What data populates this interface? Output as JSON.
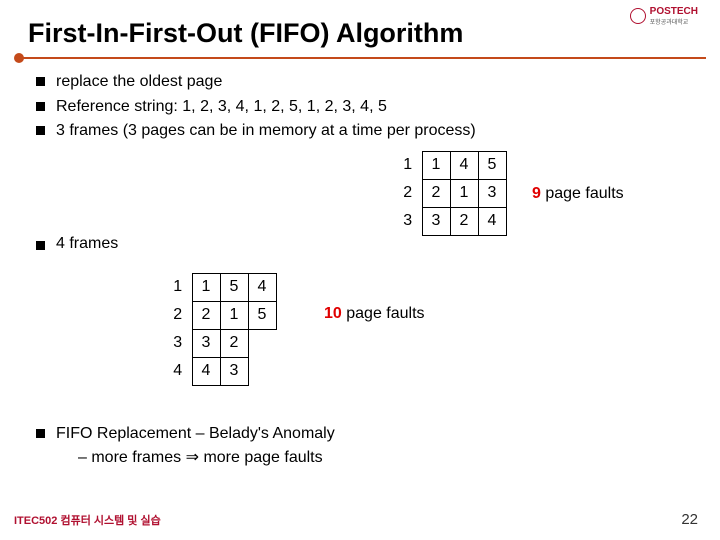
{
  "logo": {
    "name": "POSTECH",
    "sub": "포항공과대학교"
  },
  "title": "First-In-First-Out (FIFO) Algorithm",
  "bullets": {
    "b1": "replace the oldest page",
    "b2": "Reference string: 1, 2, 3, 4, 1, 2, 5, 1, 2, 3, 4, 5",
    "b3": "3 frames (3 pages can be in memory at a time per process)"
  },
  "frames4_label": "4 frames",
  "table3": {
    "r1": {
      "lead": "1",
      "c1": "1",
      "c2": "4",
      "c3": "5"
    },
    "r2": {
      "lead": "2",
      "c1": "2",
      "c2": "1",
      "c3": "3"
    },
    "r3": {
      "lead": "3",
      "c1": "3",
      "c2": "2",
      "c3": "4"
    }
  },
  "faults3": {
    "num": "9",
    "text": " page faults"
  },
  "table4": {
    "r1": {
      "lead": "1",
      "c1": "1",
      "c2": "5",
      "c3": "4"
    },
    "r2": {
      "lead": "2",
      "c1": "2",
      "c2": "1",
      "c3": "5"
    },
    "r3": {
      "lead": "3",
      "c1": "3",
      "c2": "2",
      "c3": ""
    },
    "r4": {
      "lead": "4",
      "c1": "4",
      "c2": "3",
      "c3": ""
    }
  },
  "faults4": {
    "num": "10",
    "text": " page faults"
  },
  "belady": {
    "line": "FIFO Replacement – Belady's Anomaly",
    "sub_prefix": "– more frames ",
    "sub_arrow": "⇒",
    "sub_suffix": " more page faults"
  },
  "footer": {
    "left": "ITEC502 컴퓨터 시스템 및 실습",
    "page": "22"
  }
}
